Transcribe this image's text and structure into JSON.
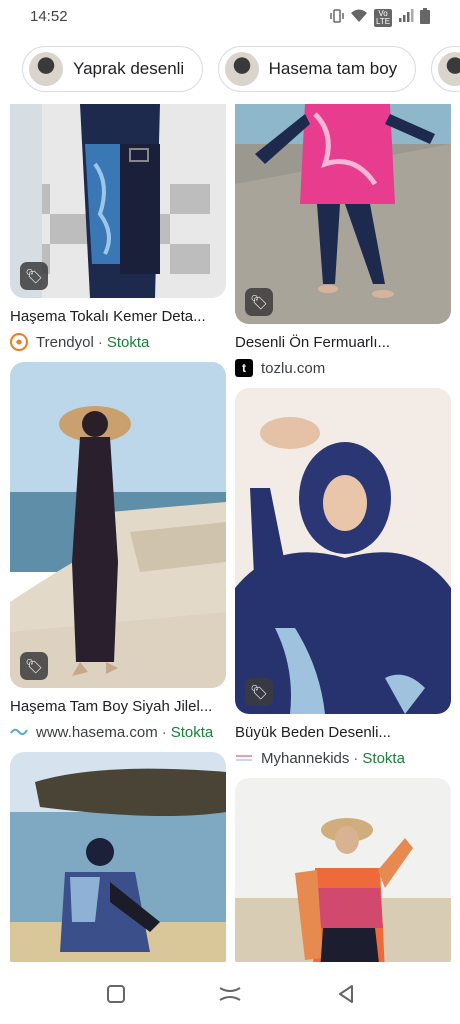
{
  "status": {
    "time": "14:52",
    "icons": [
      "vibrate-icon",
      "wifi-icon",
      "volte-icon",
      "signal-icon",
      "battery-icon"
    ],
    "volte_text": "Vo LTE"
  },
  "chips": [
    {
      "label": "Yaprak desenli"
    },
    {
      "label": "Hasema tam boy"
    },
    {
      "label": ""
    }
  ],
  "results": {
    "left": [
      {
        "title": "Haşema Tokalı Kemer Deta...",
        "source": "Trendyol",
        "stock": "Stokta",
        "source_icon": "T"
      },
      {
        "title": "Haşema Tam Boy Siyah Jilel...",
        "source": "www.hasema.com",
        "stock": "Stokta",
        "source_icon": "~"
      },
      {
        "title": "",
        "source": "",
        "stock": "",
        "source_icon": ""
      }
    ],
    "right": [
      {
        "title": "Desenli Ön Fermuarlı...",
        "source": "tozlu.com",
        "stock": "",
        "source_icon": "t"
      },
      {
        "title": "Büyük Beden Desenli...",
        "source": "Myhannekids",
        "stock": "Stokta",
        "source_icon": "≡"
      },
      {
        "title": "",
        "source": "",
        "stock": "",
        "source_icon": ""
      }
    ]
  },
  "separator": "·",
  "colors": {
    "stock": "#188038",
    "trendyol": "#f27a1a",
    "tozlu": "#000000"
  }
}
